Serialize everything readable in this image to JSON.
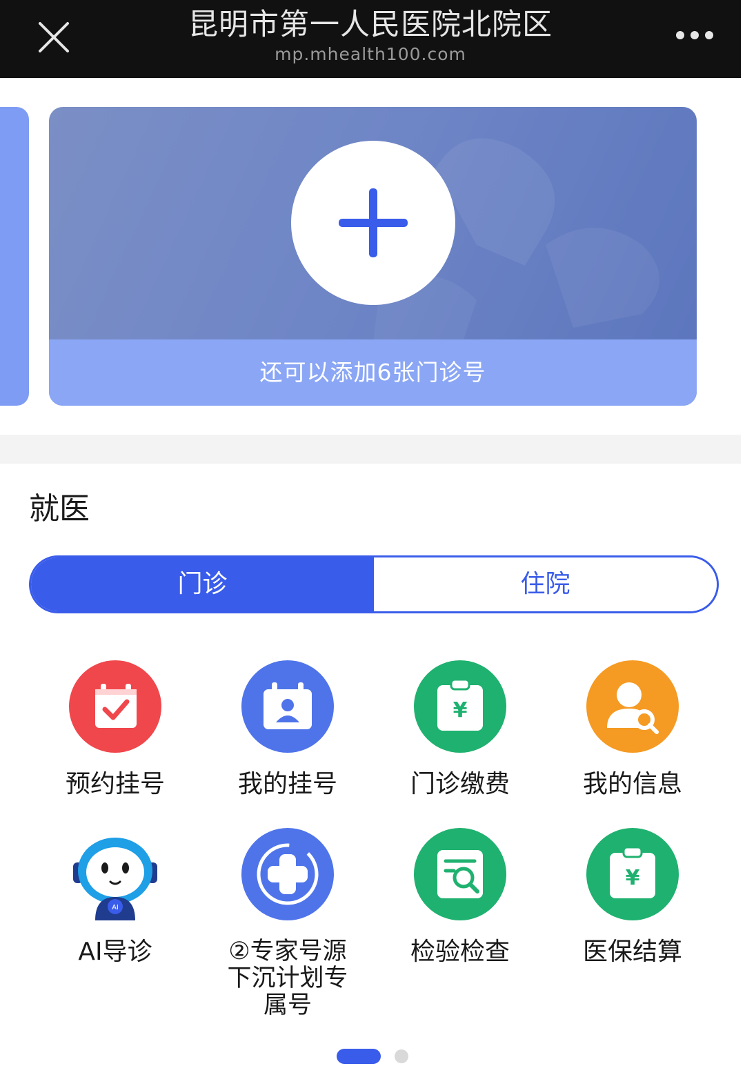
{
  "header": {
    "title": "昆明市第一人民医院北院区",
    "url": "mp.mhealth100.com",
    "close_icon": "close-icon",
    "more_icon": "more-icon"
  },
  "card": {
    "add_icon": "plus-icon",
    "caption": "还可以添加6张门诊号"
  },
  "section": {
    "title": "就医"
  },
  "tabs": {
    "active_label": "门诊",
    "inactive_label": "住院",
    "active_color": "#3a5cea"
  },
  "services": [
    {
      "label": "预约挂号",
      "icon": "calendar-check-icon",
      "color": "#f0474c"
    },
    {
      "label": "我的挂号",
      "icon": "calendar-user-icon",
      "color": "#4f74ea"
    },
    {
      "label": "门诊缴费",
      "icon": "clipboard-yuan-icon",
      "color": "#1fb16f"
    },
    {
      "label": "我的信息",
      "icon": "user-search-icon",
      "color": "#f59a23"
    },
    {
      "label": "AI导诊",
      "icon": "robot-icon",
      "color": "#1e9fe6"
    },
    {
      "label": "②专家号源下沉计划专属号",
      "icon": "medical-cross-icon",
      "color": "#4f74ea"
    },
    {
      "label": "检验检查",
      "icon": "document-search-icon",
      "color": "#1fb16f"
    },
    {
      "label": "医保结算",
      "icon": "clipboard-yuan-icon",
      "color": "#1fb16f"
    }
  ],
  "pager": {
    "current": 1,
    "total": 2
  }
}
